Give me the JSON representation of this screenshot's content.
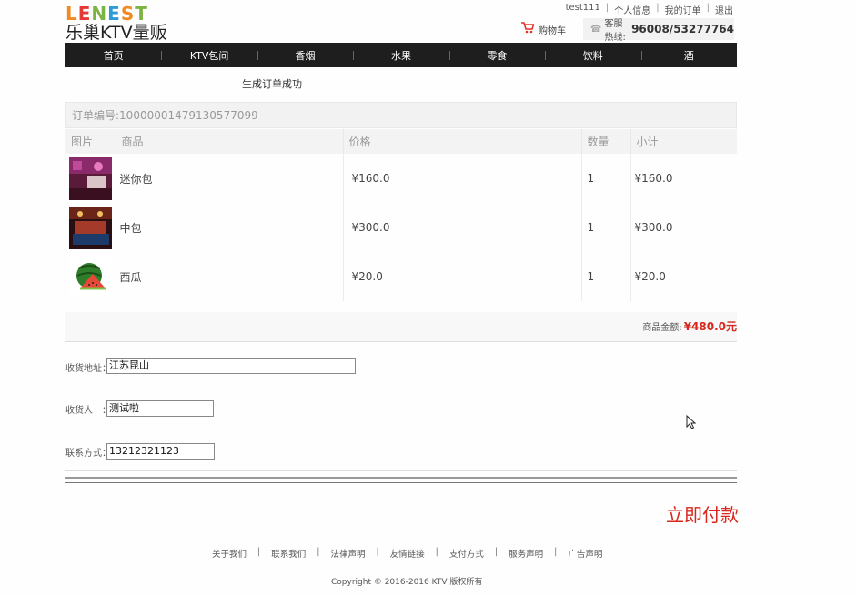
{
  "logo": {
    "letters": [
      "L",
      "E",
      "N",
      "E",
      "S",
      "T"
    ],
    "letter_colors": [
      "#f08a24",
      "#e53935",
      "#7cb342",
      "#2e9bd6",
      "#f08a24",
      "#7cb342"
    ],
    "subtitle": "乐巢KTV量贩"
  },
  "toplinks": {
    "user": "test111",
    "profile": "个人信息",
    "orders": "我的订单",
    "logout": "退出",
    "separator": "|"
  },
  "cart": {
    "icon": "cart-icon",
    "label": "购物车"
  },
  "hotline": {
    "label": "客服热线:",
    "number": "96008/53277764"
  },
  "nav": {
    "items": [
      {
        "label": "首页"
      },
      {
        "label": "KTV包间"
      },
      {
        "label": "香烟"
      },
      {
        "label": "水果"
      },
      {
        "label": "零食"
      },
      {
        "label": "饮料"
      },
      {
        "label": "酒"
      }
    ]
  },
  "status": "生成订单成功",
  "order": {
    "number_text": "订单编号:10000001479130577099",
    "columns": [
      "图片",
      "商品",
      "价格",
      "数量",
      "小计"
    ],
    "rows": [
      {
        "name": "迷你包",
        "price": "¥160.0",
        "qty": "1",
        "subtotal": "¥160.0",
        "thumb": "room-photo"
      },
      {
        "name": "中包",
        "price": "¥300.0",
        "qty": "1",
        "subtotal": "¥300.0",
        "thumb": "room-photo"
      },
      {
        "name": "西瓜",
        "price": "¥20.0",
        "qty": "1",
        "subtotal": "¥20.0",
        "thumb": "watermelon"
      }
    ],
    "total_label": "商品金额:",
    "total_value": "¥480.0元"
  },
  "form": {
    "address_label": "收货地址：",
    "address_value": "江苏昆山",
    "receiver_label": "收货人　：",
    "receiver_value": "测试啦",
    "phone_label": "联系方式：",
    "phone_value": "13212321123"
  },
  "pay_button": "立即付款",
  "footer": {
    "links": [
      "关于我们",
      "联系我们",
      "法律声明",
      "友情链接",
      "支付方式",
      "服务声明",
      "广告声明"
    ],
    "separator": "|",
    "copyright": "Copyright © 2016-2016 KTV 版权所有"
  },
  "colors": {
    "accent": "#d6281e",
    "nav_bg": "#1e1e1e"
  }
}
